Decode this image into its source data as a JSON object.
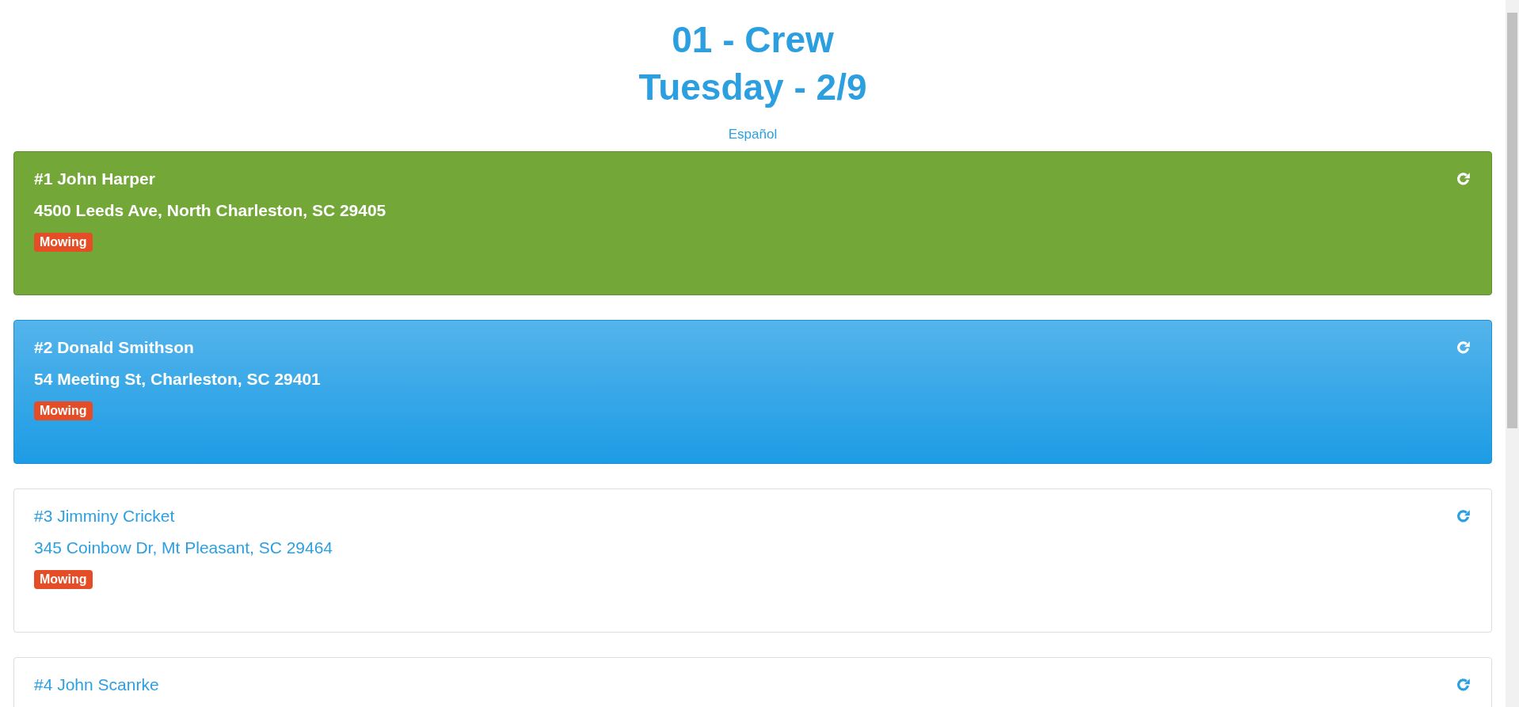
{
  "header": {
    "crew": "01 - Crew",
    "day": "Tuesday - 2/9",
    "language_link": "Español"
  },
  "stops": [
    {
      "number": "#1",
      "name": "John Harper",
      "address": "4500 Leeds Ave, North Charleston, SC 29405",
      "tag": "Mowing",
      "kind": "done"
    },
    {
      "number": "#2",
      "name": "Donald Smithson",
      "address": "54 Meeting St, Charleston, SC 29401",
      "tag": "Mowing",
      "kind": "current"
    },
    {
      "number": "#3",
      "name": "Jimminy Cricket",
      "address": "345 Coinbow Dr, Mt Pleasant, SC 29464",
      "tag": "Mowing",
      "kind": "pending"
    },
    {
      "number": "#4",
      "name": "John Scanrke",
      "kind": "pending"
    }
  ]
}
